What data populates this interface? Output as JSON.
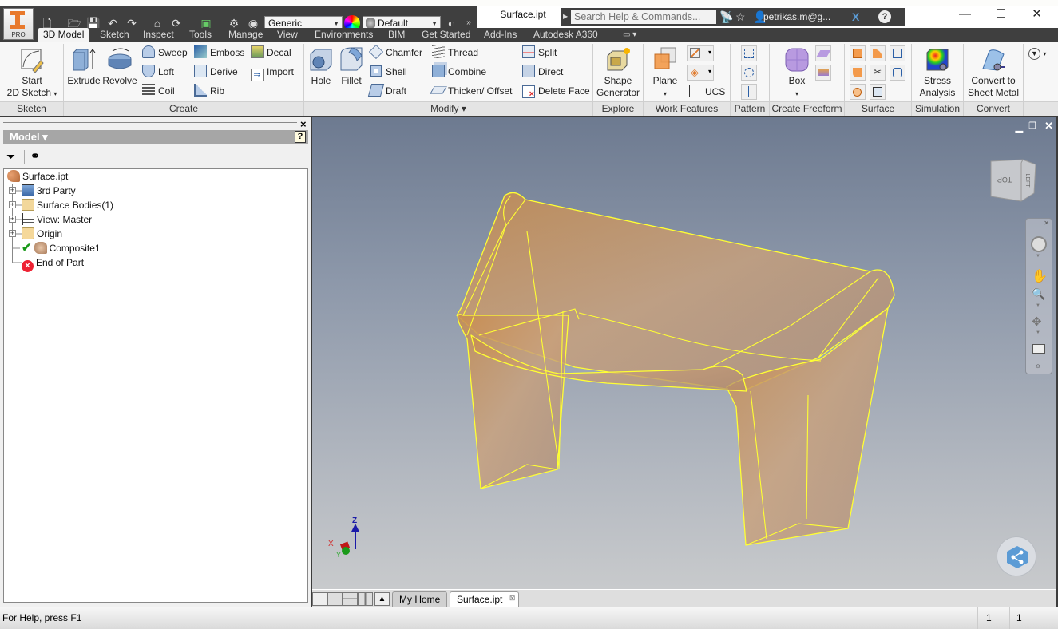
{
  "app": {
    "edition_badge": "PRO",
    "document_title": "Surface.ipt",
    "quick_access": {
      "material_select": "Generic",
      "appearance_select": "Default",
      "icons": [
        "new-icon",
        "open-icon",
        "save-icon",
        "undo-icon",
        "redo-icon",
        "home-icon",
        "update-icon",
        "select-icon",
        "ilogic-icon",
        "appearance-icon",
        "color-wheel-icon",
        "overflow-icon"
      ]
    },
    "search": {
      "placeholder": "Search Help & Commands..."
    },
    "user": "petrikas.m@g...",
    "window_controls": {
      "minimize": "—",
      "maximize": "☐",
      "close": "✕"
    }
  },
  "ribbon_tabs": [
    {
      "label": "3D Model",
      "active": true
    },
    {
      "label": "Sketch"
    },
    {
      "label": "Inspect"
    },
    {
      "label": "Tools"
    },
    {
      "label": "Manage"
    },
    {
      "label": "View"
    },
    {
      "label": "Environments"
    },
    {
      "label": "BIM"
    },
    {
      "label": "Get Started"
    },
    {
      "label": "Add-Ins"
    },
    {
      "label": "Autodesk A360"
    }
  ],
  "ribbon": {
    "sketch": {
      "title": "Sketch",
      "start_line1": "Start",
      "start_line2": "2D Sketch"
    },
    "create": {
      "title": "Create",
      "extrude": "Extrude",
      "revolve": "Revolve",
      "sweep": "Sweep",
      "loft": "Loft",
      "coil": "Coil",
      "emboss": "Emboss",
      "derive": "Derive",
      "rib": "Rib",
      "decal": "Decal",
      "import": "Import"
    },
    "modify": {
      "title": "Modify ▾",
      "hole": "Hole",
      "fillet": "Fillet",
      "chamfer": "Chamfer",
      "shell": "Shell",
      "draft": "Draft",
      "thread": "Thread",
      "combine": "Combine",
      "thicken": "Thicken/ Offset",
      "split": "Split",
      "direct": "Direct",
      "delete_face": "Delete Face"
    },
    "explore": {
      "title": "Explore",
      "shape_line1": "Shape",
      "shape_line2": "Generator"
    },
    "work_features": {
      "title": "Work Features",
      "plane": "Plane",
      "ucs": "UCS"
    },
    "pattern": {
      "title": "Pattern"
    },
    "freeform": {
      "title": "Create Freeform",
      "box": "Box"
    },
    "surface": {
      "title": "Surface"
    },
    "simulation": {
      "title": "Simulation",
      "line1": "Stress",
      "line2": "Analysis"
    },
    "convert": {
      "title": "Convert",
      "line1": "Convert to",
      "line2": "Sheet Metal"
    }
  },
  "browser": {
    "title": "Model ▾",
    "close": "×",
    "help": "?",
    "tree": [
      {
        "label": "Surface.ipt",
        "icon": "part-icon",
        "expandable": false
      },
      {
        "label": "3rd Party",
        "icon": "third-party-icon",
        "expandable": true
      },
      {
        "label": "Surface Bodies(1)",
        "icon": "surface-bodies-icon",
        "expandable": true
      },
      {
        "label": "View: Master",
        "icon": "view-rep-icon",
        "expandable": true
      },
      {
        "label": "Origin",
        "icon": "folder-icon",
        "expandable": true
      },
      {
        "label": "Composite1",
        "icon": "composite-icon",
        "expandable": false
      },
      {
        "label": "End of Part",
        "icon": "end-of-part-icon",
        "expandable": false
      }
    ]
  },
  "viewport": {
    "viewcube_faces": [
      "TOP",
      "LEFT"
    ],
    "triad": {
      "x": "X",
      "y": "Y",
      "z": "Z"
    },
    "model_highlight_color": "#ffff33",
    "model_fill_color": "#c8955e"
  },
  "doc_tabs": [
    {
      "label": "My Home",
      "active": false
    },
    {
      "label": "Surface.ipt",
      "active": true
    }
  ],
  "status": {
    "help": "For Help, press F1",
    "count1": "1",
    "count2": "1"
  }
}
